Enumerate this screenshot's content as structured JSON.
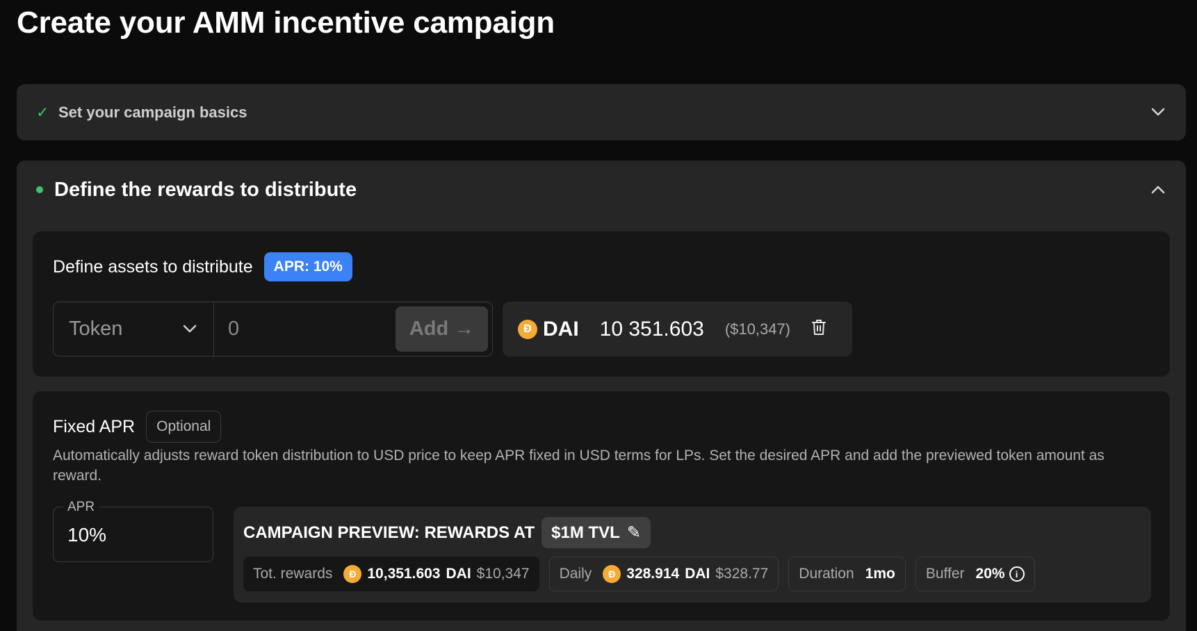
{
  "page": {
    "title": "Create your AMM incentive campaign"
  },
  "step1": {
    "check_icon": "✓",
    "label": "Set your campaign basics",
    "chevron": "⌄"
  },
  "step2": {
    "label": "Define the rewards to distribute",
    "chevron": "⌃",
    "assets": {
      "title": "Define assets to distribute",
      "apr_badge": "APR: 10%",
      "token_placeholder": "Token",
      "amount_placeholder": "0",
      "add_label": "Add",
      "add_arrow": "→",
      "reward": {
        "coin_glyph": "Đ",
        "symbol": "DAI",
        "amount": "10 351.603",
        "usd": "($10,347)",
        "trash_icon": "🗑"
      }
    },
    "fixed_apr": {
      "title": "Fixed APR",
      "optional": "Optional",
      "description": "Automatically adjusts reward token distribution to USD price to keep APR fixed in USD terms for LPs. Set the desired APR and add the previewed token amount as reward.",
      "apr_legend": "APR",
      "apr_value": "10%",
      "preview": {
        "title": "CAMPAIGN PREVIEW: REWARDS AT",
        "tvl": "$1M TVL",
        "pencil": "✎",
        "total": {
          "label": "Tot. rewards",
          "amount": "10,351.603",
          "unit": "DAI",
          "usd": "$10,347"
        },
        "daily": {
          "label": "Daily",
          "amount": "328.914",
          "unit": "DAI",
          "usd": "$328.77"
        },
        "duration": {
          "label": "Duration",
          "value": "1mo"
        },
        "buffer": {
          "label": "Buffer",
          "value": "20%",
          "info": "i"
        }
      }
    }
  },
  "colors": {
    "accent_green": "#3ec46d",
    "apr_badge_blue": "#3b82f6",
    "dai_orange": "#f5ac37"
  }
}
